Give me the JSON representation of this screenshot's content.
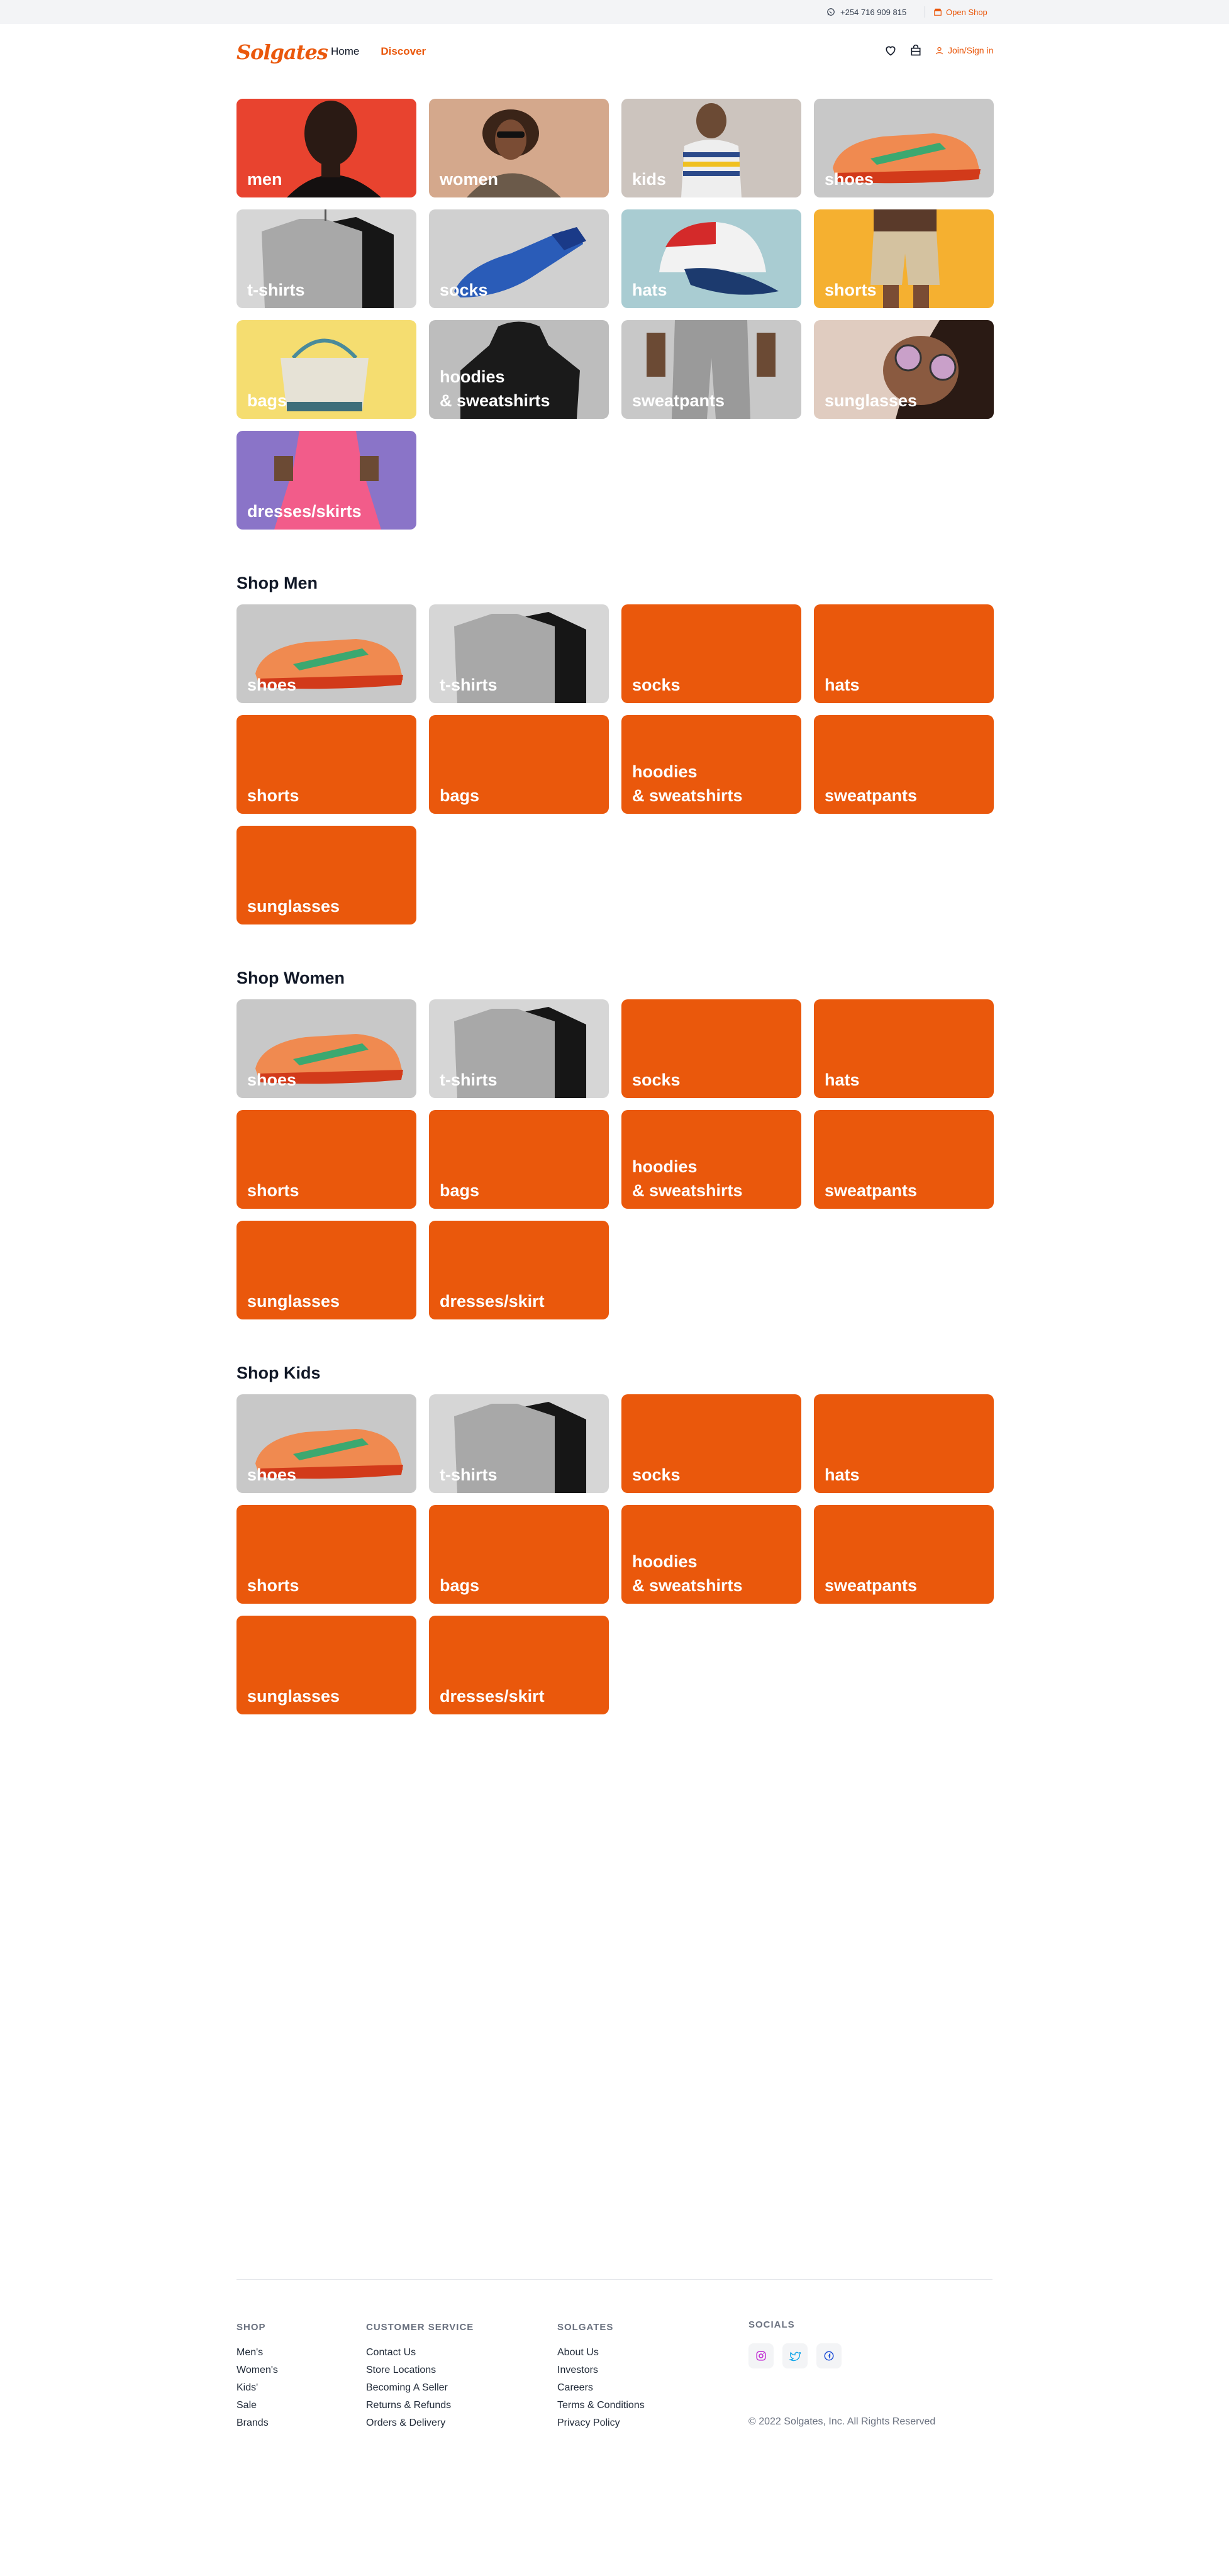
{
  "topbar": {
    "phone": "+254 716 909 815",
    "open_shop": "Open Shop"
  },
  "header": {
    "logo": "Solgates",
    "nav": [
      "Home",
      "Discover"
    ],
    "join": "Join/Sign in"
  },
  "discover": {
    "tiles": [
      {
        "label": "men",
        "icon": "portrait-man"
      },
      {
        "label": "women",
        "icon": "portrait-woman"
      },
      {
        "label": "kids",
        "icon": "portrait-kid"
      },
      {
        "label": "shoes",
        "icon": "sneaker"
      },
      {
        "label": "t-shirts",
        "icon": "tshirts"
      },
      {
        "label": "socks",
        "icon": "socks"
      },
      {
        "label": "hats",
        "icon": "cap"
      },
      {
        "label": "shorts",
        "icon": "shorts"
      },
      {
        "label": "bags",
        "icon": "tote-bag"
      },
      {
        "label": "hoodies\n& sweatshirts",
        "icon": "hoodie"
      },
      {
        "label": "sweatpants",
        "icon": "sweatpants"
      },
      {
        "label": "sunglasses",
        "icon": "sunglasses"
      },
      {
        "label": "dresses/skirts",
        "icon": "dress"
      }
    ]
  },
  "sections": [
    {
      "title": "Shop Men",
      "tiles": [
        "shoes",
        "t-shirts",
        "socks",
        "hats",
        "shorts",
        "bags",
        "hoodies\n& sweatshirts",
        "sweatpants",
        "sunglasses"
      ]
    },
    {
      "title": "Shop Women",
      "tiles": [
        "shoes",
        "t-shirts",
        "socks",
        "hats",
        "shorts",
        "bags",
        "hoodies\n& sweatshirts",
        "sweatpants",
        "sunglasses",
        "dresses/skirt"
      ]
    },
    {
      "title": "Shop Kids",
      "tiles": [
        "shoes",
        "t-shirts",
        "socks",
        "hats",
        "shorts",
        "bags",
        "hoodies\n& sweatshirts",
        "sweatpants",
        "sunglasses",
        "dresses/skirt"
      ]
    }
  ],
  "footer": {
    "shop": {
      "heading": "SHOP",
      "links": [
        "Men's",
        "Women's",
        "Kids'",
        "Sale",
        "Brands"
      ]
    },
    "customer_service": {
      "heading": "CUSTOMER SERVICE",
      "links": [
        "Contact Us",
        "Store Locations",
        "Becoming A Seller",
        "Returns & Refunds",
        "Orders & Delivery"
      ]
    },
    "solgates": {
      "heading": "SOLGATES",
      "links": [
        "About Us",
        "Investors",
        "Careers",
        "Terms & Conditions",
        "Privacy Policy"
      ]
    },
    "socials": {
      "heading": "SOCIALS",
      "icons": [
        "instagram-icon",
        "twitter-icon",
        "facebook-icon"
      ]
    },
    "copyright": "© 2022 Solgates, Inc. All Rights Reserved"
  },
  "colors": {
    "accent": "#ea580c",
    "topbar_bg": "#f3f4f6"
  }
}
